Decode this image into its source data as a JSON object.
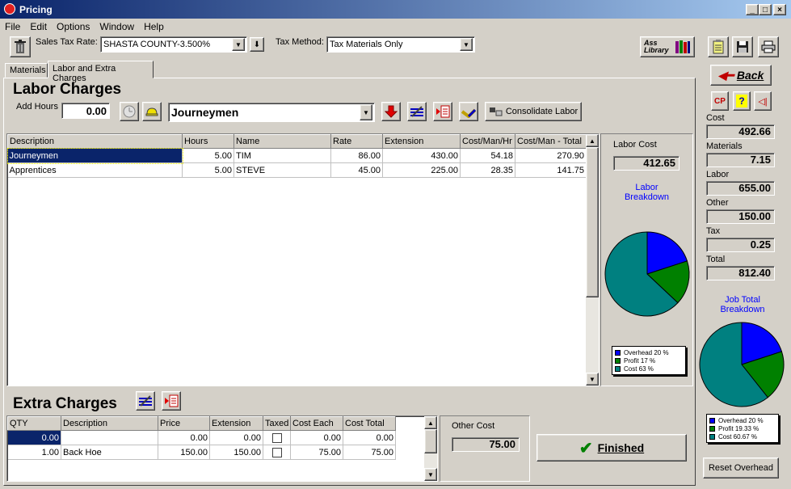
{
  "window": {
    "title": "Pricing"
  },
  "menu": [
    "File",
    "Edit",
    "Options",
    "Window",
    "Help"
  ],
  "toolbar": {
    "sales_tax_label": "Sales Tax Rate:",
    "sales_tax_value": "SHASTA COUNTY-3.500%",
    "tax_method_label": "Tax Method:",
    "tax_method_value": "Tax Materials Only",
    "library_label": "Ass Library"
  },
  "tabs": [
    "Materials",
    "Labor and Extra Charges"
  ],
  "labor": {
    "title": "Labor Charges",
    "add_hours_label": "Add Hours",
    "add_hours_value": "0.00",
    "labor_type": "Journeymen",
    "consolidate_label": "Consolidate Labor",
    "columns": [
      "Description",
      "Hours",
      "Name",
      "Rate",
      "Extension",
      "Cost/Man/Hr",
      "Cost/Man - Total"
    ],
    "rows": [
      [
        "Journeymen",
        "5.00",
        "TIM",
        "86.00",
        "430.00",
        "54.18",
        "270.90"
      ],
      [
        "Apprentices",
        "5.00",
        "STEVE",
        "45.00",
        "225.00",
        "28.35",
        "141.75"
      ]
    ],
    "labor_cost_label": "Labor Cost",
    "labor_cost_value": "412.65",
    "breakdown_title_1": "Labor",
    "breakdown_title_2": "Breakdown",
    "pie": [
      {
        "label": "Overhead 20 %",
        "value": 20,
        "color": "#0000ff"
      },
      {
        "label": "Profit 17 %",
        "value": 17,
        "color": "#008000"
      },
      {
        "label": "Cost 63 %",
        "value": 63,
        "color": "#008080"
      }
    ]
  },
  "extra": {
    "title": "Extra Charges",
    "columns": [
      "QTY",
      "Description",
      "Price",
      "Extension",
      "Taxed",
      "Cost Each",
      "Cost Total"
    ],
    "rows": [
      [
        "0.00",
        "",
        "0.00",
        "0.00",
        "",
        "0.00",
        "0.00"
      ],
      [
        "1.00",
        "Back Hoe",
        "150.00",
        "150.00",
        "",
        "75.00",
        "75.00"
      ]
    ],
    "other_cost_label": "Other Cost",
    "other_cost_value": "75.00",
    "finished_label": "Finished"
  },
  "side": {
    "back_label": "Back",
    "cp_label": "CP",
    "help_label": "?",
    "totals": [
      {
        "label": "Cost",
        "value": "492.66"
      },
      {
        "label": "Materials",
        "value": "7.15"
      },
      {
        "label": "Labor",
        "value": "655.00"
      },
      {
        "label": "Other",
        "value": "150.00"
      },
      {
        "label": "Tax",
        "value": "0.25"
      },
      {
        "label": "Total",
        "value": "812.40"
      }
    ],
    "breakdown_title_1": "Job Total",
    "breakdown_title_2": "Breakdown",
    "pie": [
      {
        "label": "Overhead 20 %",
        "value": 20,
        "color": "#0000ff"
      },
      {
        "label": "Profit 19.33 %",
        "value": 19.33,
        "color": "#008000"
      },
      {
        "label": "Cost 60.67 %",
        "value": 60.67,
        "color": "#008080"
      }
    ],
    "reset_label": "Reset Overhead"
  }
}
